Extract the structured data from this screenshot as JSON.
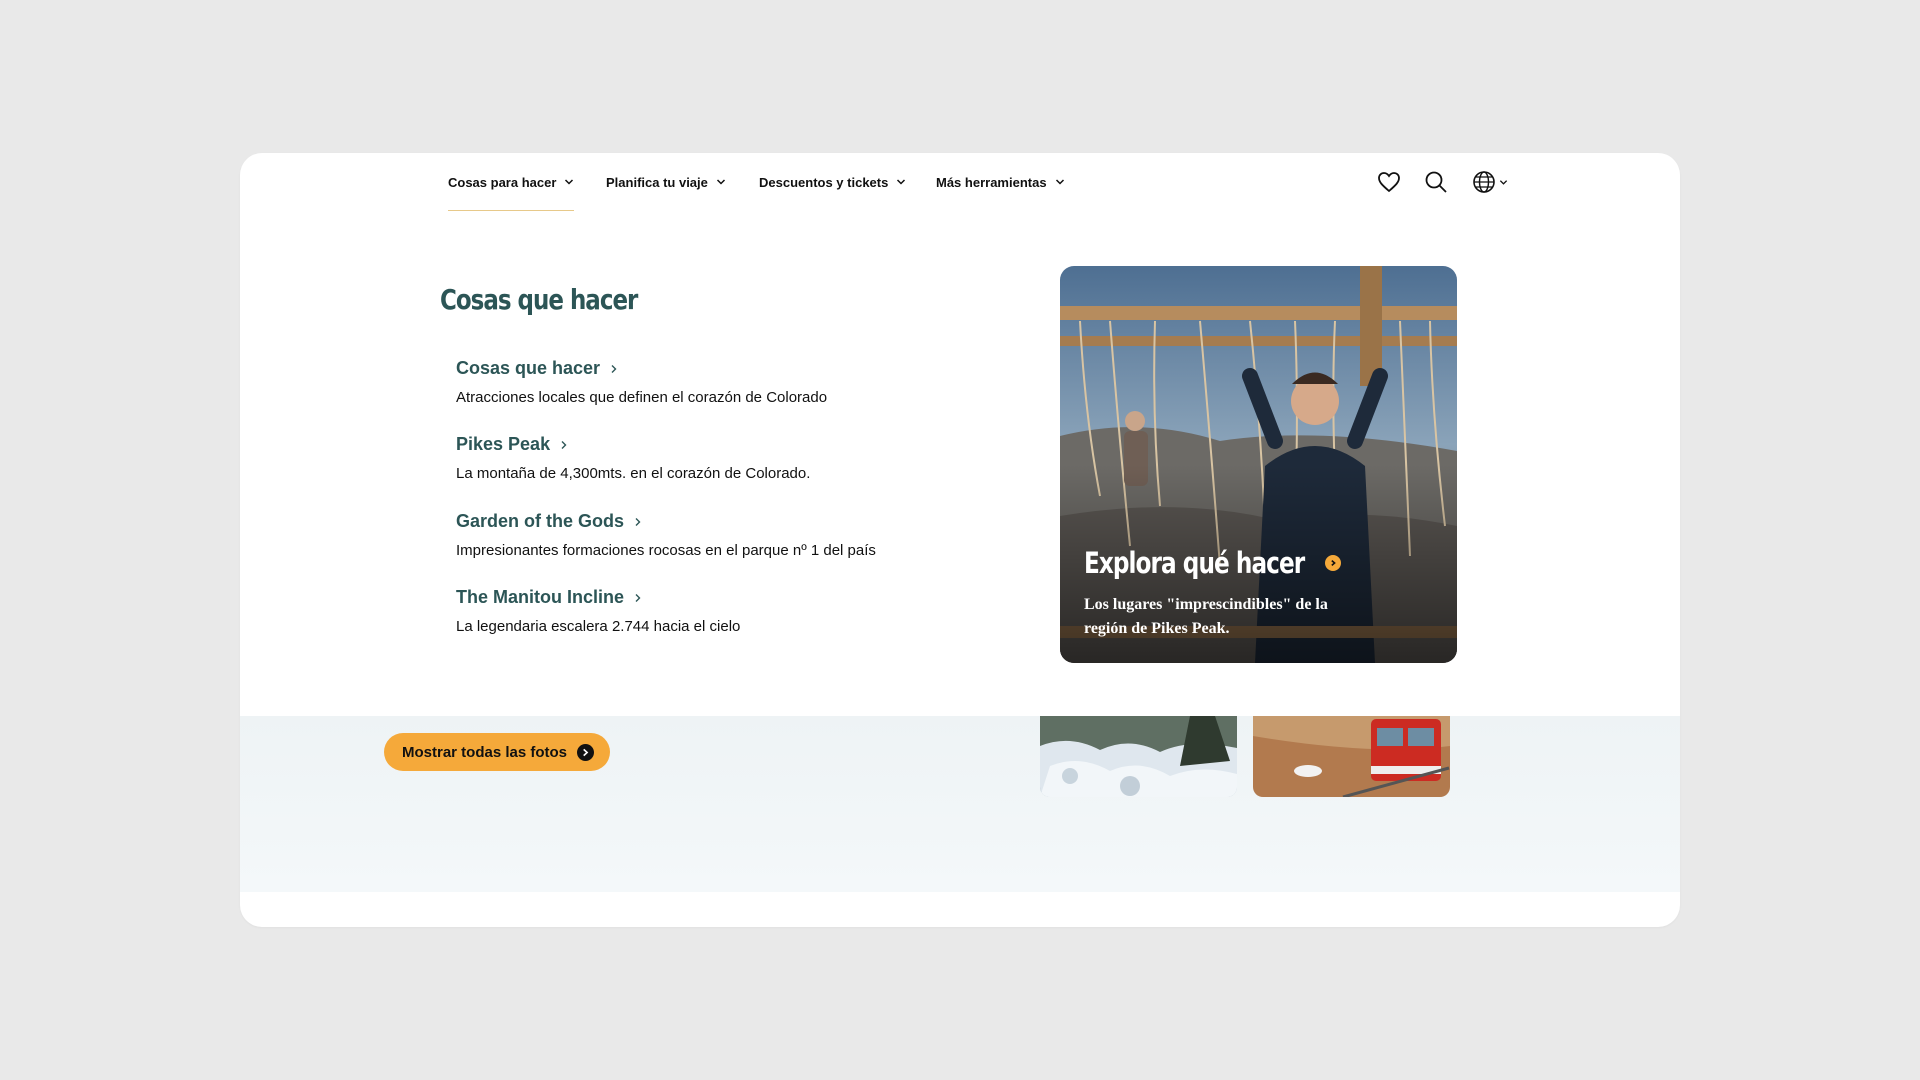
{
  "nav": {
    "items": [
      {
        "label": "Cosas para hacer",
        "active": true
      },
      {
        "label": "Planifica tu viaje"
      },
      {
        "label": "Descuentos y tickets"
      },
      {
        "label": "Más herramientas"
      }
    ],
    "icons": [
      "heart-icon",
      "search-icon",
      "globe-icon"
    ]
  },
  "menu": {
    "title": "Cosas que hacer",
    "links": [
      {
        "title": "Cosas que hacer",
        "desc": "Atracciones locales que definen el corazón de Colorado"
      },
      {
        "title": "Pikes Peak",
        "desc": "La montaña de 4,300mts. en el corazón de Colorado."
      },
      {
        "title": "Garden of the Gods",
        "desc": "Impresionantes formaciones rocosas en el parque nº 1 del país"
      },
      {
        "title": "The Manitou Incline",
        "desc": "La legendaria escalera 2.744 hacia el cielo"
      }
    ],
    "promo": {
      "title": "Explora qué hacer",
      "desc": "Los lugares \"imprescindibles\" de la región de Pikes Peak."
    }
  },
  "page": {
    "photos_button": "Mostrar todas las fotos"
  },
  "colors": {
    "heading": "#2c5556",
    "accent": "#f5a93a",
    "active_underline": "#e7c98a",
    "background": "#e9e9e9"
  }
}
